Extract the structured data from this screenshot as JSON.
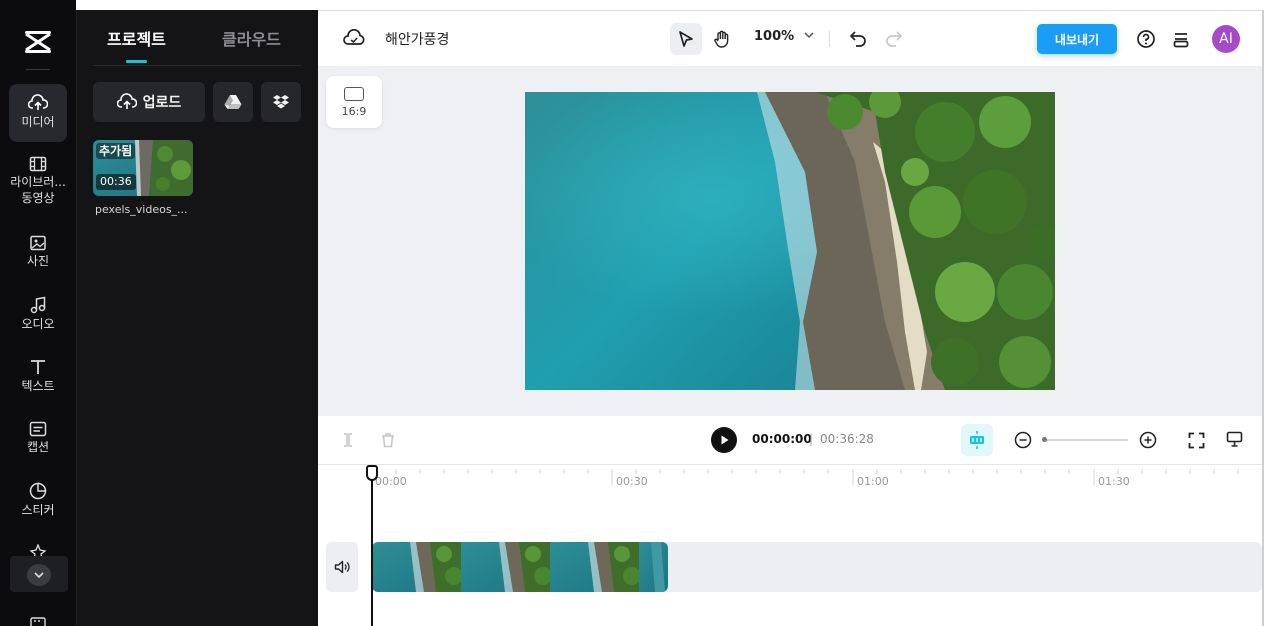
{
  "rail": {
    "items": [
      {
        "label": "미디어",
        "icon": "cloud-upload-icon"
      },
      {
        "label": "라이브러...",
        "label2": "동영상",
        "icon": "film-icon"
      },
      {
        "label": "사진",
        "icon": "image-icon"
      },
      {
        "label": "오디오",
        "icon": "music-note-icon"
      },
      {
        "label": "텍스트",
        "icon": "text-t-icon"
      },
      {
        "label": "캡션",
        "icon": "caption-icon"
      },
      {
        "label": "스티커",
        "icon": "sticker-icon"
      }
    ]
  },
  "panel": {
    "tabs": [
      "프로젝트",
      "클라우드"
    ],
    "upload_label": "업로드",
    "media": [
      {
        "tag": "추가됨",
        "duration": "00:36",
        "filename": "pexels_videos_..."
      }
    ]
  },
  "topbar": {
    "project_title": "해안가풍경",
    "zoom": "100%",
    "export_label": "내보내기",
    "avatar_initials": "AI"
  },
  "stage": {
    "aspect_ratio": "16:9"
  },
  "playback": {
    "current_time": "00:00:00",
    "separator": "|",
    "total_time": "00:36:28"
  },
  "timeline": {
    "ticks": [
      "00:00",
      "00:30",
      "01:00",
      "01:30"
    ]
  },
  "colors": {
    "accent": "#19c4d8",
    "export": "#1a9ef5",
    "avatar": "#a64ac9",
    "rail_bg": "#0c0c0e",
    "panel_bg": "#141416"
  }
}
